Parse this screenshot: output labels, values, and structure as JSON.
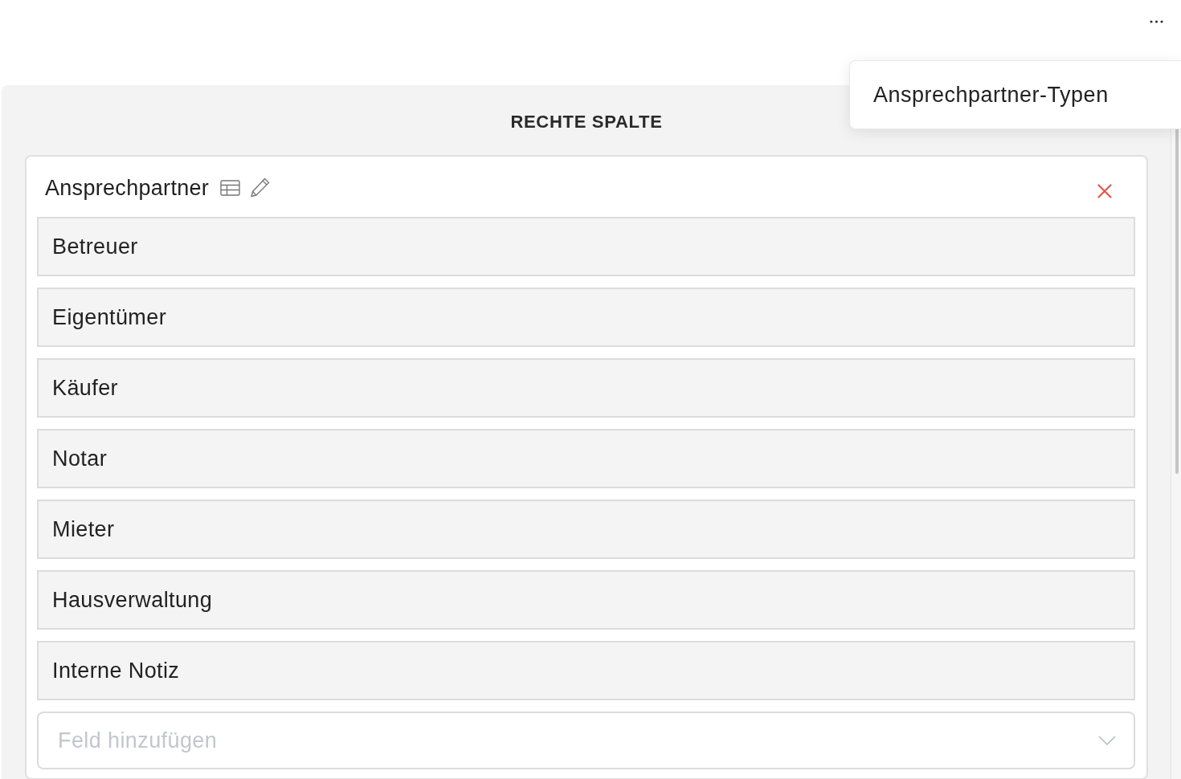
{
  "menu": {
    "items": [
      {
        "label": "Ansprechpartner-Typen"
      }
    ]
  },
  "panel": {
    "title": "RECHTE SPALTE",
    "card": {
      "title": "Ansprechpartner",
      "fields": [
        {
          "label": "Betreuer"
        },
        {
          "label": "Eigentümer"
        },
        {
          "label": "Käufer"
        },
        {
          "label": "Notar"
        },
        {
          "label": "Mieter"
        },
        {
          "label": "Hausverwaltung"
        },
        {
          "label": "Interne Notiz"
        }
      ],
      "add_field": {
        "placeholder": "Feld hinzufügen"
      }
    }
  }
}
